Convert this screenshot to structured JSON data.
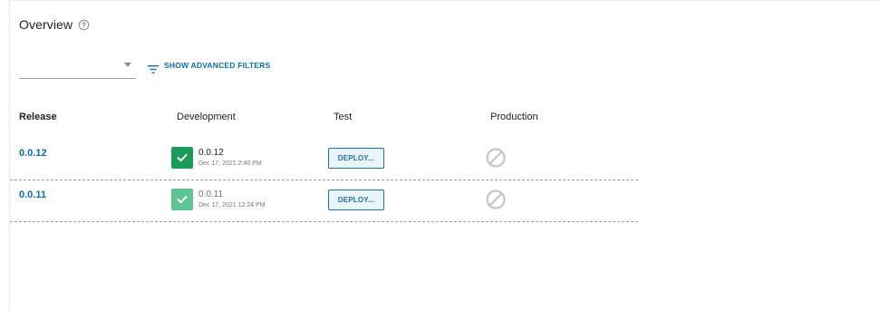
{
  "header": {
    "title": "Overview",
    "help_icon": "help-circle-icon"
  },
  "channel_select": {
    "value": "",
    "caret_icon": "chevron-down-icon"
  },
  "filters": {
    "label": "SHOW ADVANCED FILTERS",
    "icon": "filter-list-icon",
    "color": "#0a6fb3"
  },
  "table": {
    "columns": [
      "Release",
      "Development",
      "Test",
      "Production"
    ],
    "rows": [
      {
        "release": "0.0.12",
        "development": {
          "version": "0.0.12",
          "date": "Dec 17, 2021 2:40 PM",
          "status": "success-latest",
          "status_color": "#1a9b57"
        },
        "test": {
          "action": "DEPLOY..."
        },
        "production": {
          "status": "not-allowed-icon"
        }
      },
      {
        "release": "0.0.11",
        "development": {
          "version": "0.0.11",
          "date": "Dec 17, 2021 12:24 PM",
          "status": "success-previous",
          "status_color": "#5cc592"
        },
        "test": {
          "action": "DEPLOY..."
        },
        "production": {
          "status": "not-allowed-icon"
        }
      }
    ]
  },
  "colors": {
    "link": "#0a6fb3",
    "deploy_border": "#1f6fb0",
    "deploy_bg": "#eaf4fb"
  }
}
